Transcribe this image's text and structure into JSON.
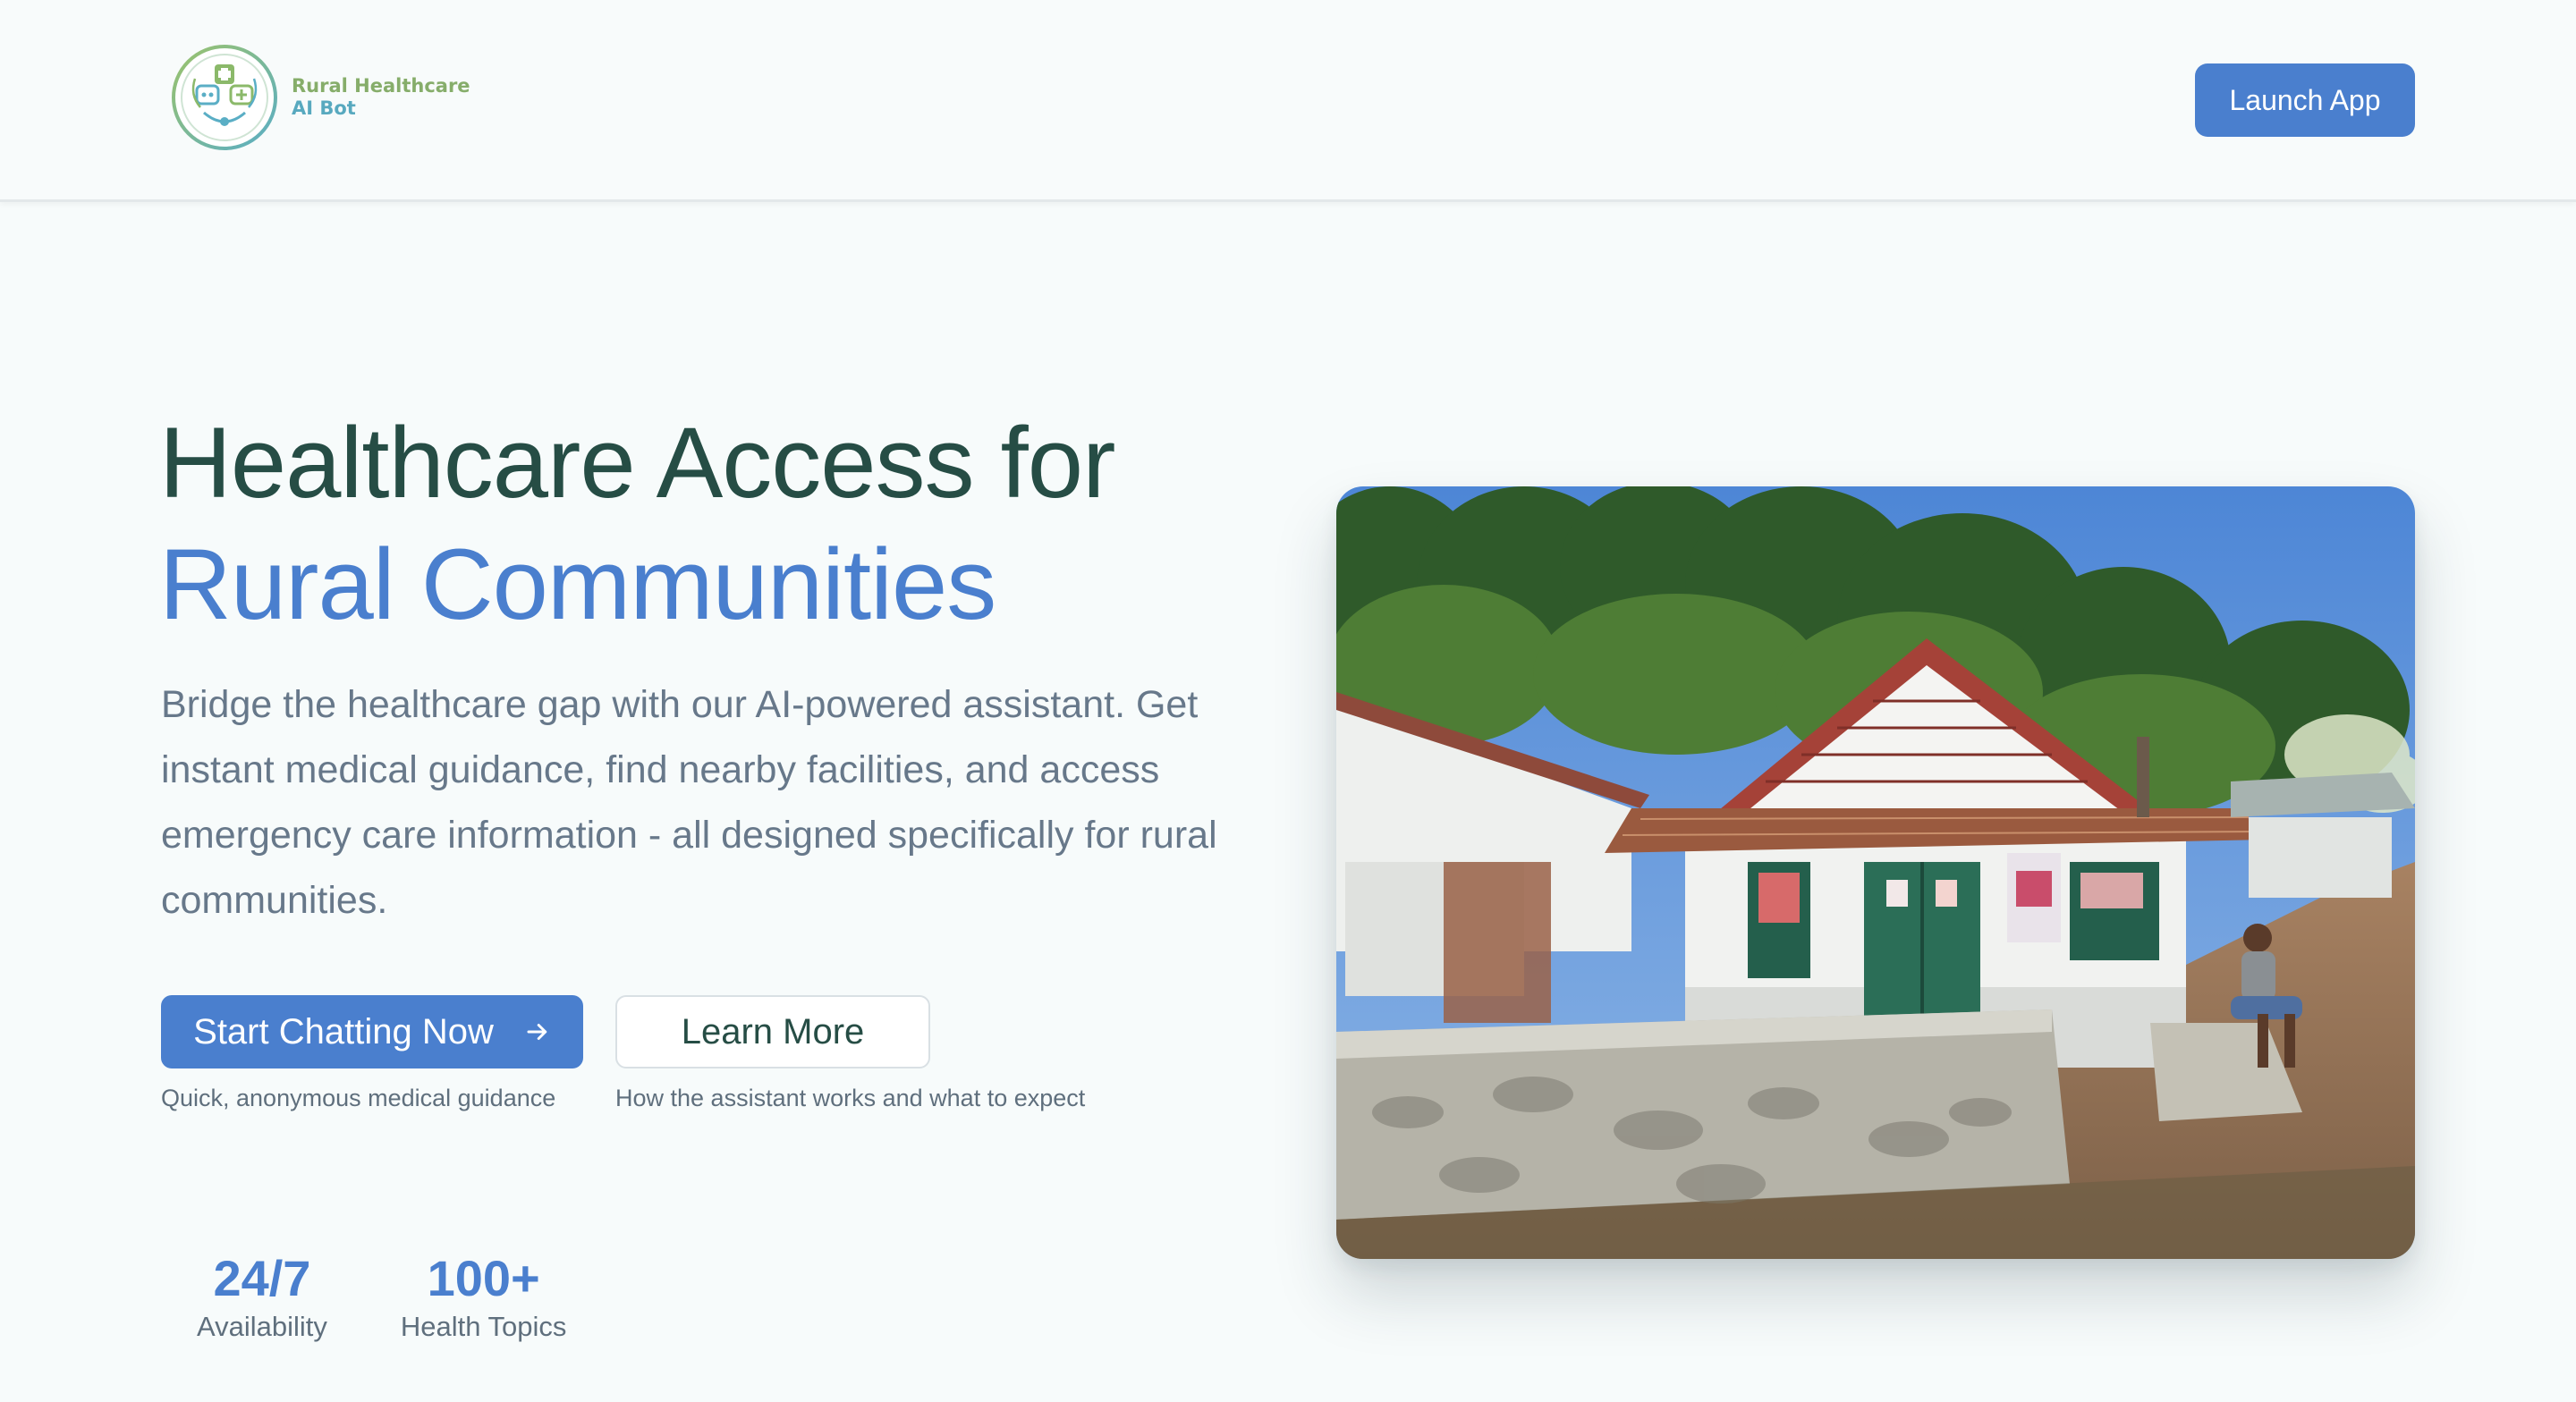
{
  "header": {
    "logo_line1": "Rural Healthcare",
    "logo_line2": "AI Bot",
    "launch_label": "Launch App"
  },
  "hero": {
    "title_line1": "Healthcare Access for",
    "title_line2": "Rural Communities",
    "description": "Bridge the healthcare gap with our AI-powered assistant. Get instant medical guidance, find nearby facilities, and access emergency care information - all designed specifically for rural communities.",
    "primary_cta": {
      "label": "Start Chatting Now",
      "icon": "arrow-right-icon",
      "caption": "Quick, anonymous medical guidance"
    },
    "secondary_cta": {
      "label": "Learn More",
      "caption": "How the assistant works and what to expect"
    }
  },
  "stats": [
    {
      "value": "24/7",
      "label": "Availability"
    },
    {
      "value": "100+",
      "label": "Health Topics"
    }
  ],
  "colors": {
    "accent": "#4a7fce",
    "heading": "#264d45",
    "body_text": "#67788a",
    "logo_green": "#86ad6a",
    "logo_teal": "#58a9bf"
  }
}
